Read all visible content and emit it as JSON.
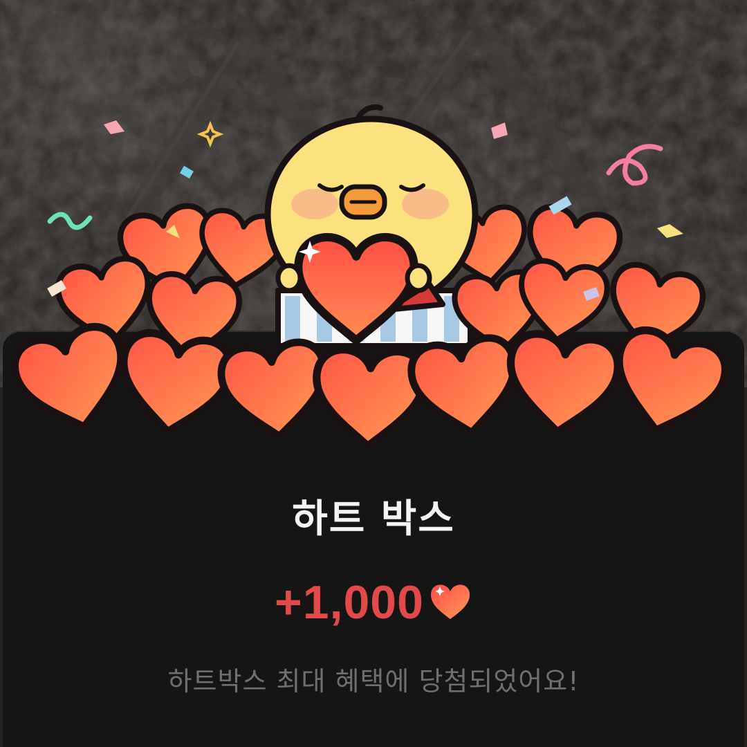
{
  "reward_popup": {
    "title": "하트 박스",
    "amount": "+1,000",
    "message": "하트박스 최대 혜택에 당첨되었어요!",
    "heart_icon": "heart-icon",
    "mascot": "chick-mascot-with-hearts",
    "colors": {
      "background": "#151515",
      "title": "#f4f4f4",
      "amount": "#e2494a",
      "message": "#6f6f6f"
    }
  }
}
